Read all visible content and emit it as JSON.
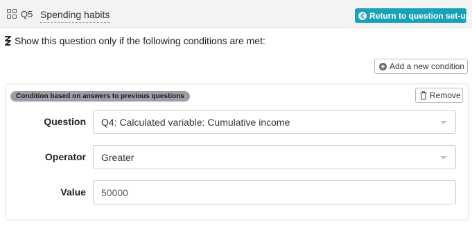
{
  "header": {
    "question_number": "Q5",
    "question_title": "Spending habits",
    "return_button_label": "Return to question set-up"
  },
  "conditions_intro": "Show this question only if the following conditions are met:",
  "add_condition_label": "Add a new condition",
  "condition": {
    "badge": "Condition based on answers to previous questions",
    "remove_label": "Remove",
    "question_label": "Question",
    "question_value": "Q4: Calculated variable: Cumulative income",
    "operator_label": "Operator",
    "operator_value": "Greater",
    "value_label": "Value",
    "value_value": "50000"
  },
  "colors": {
    "accent": "#17a2b8",
    "badge": "#9aa0a6"
  },
  "icons": {
    "question_type": "grid-icon",
    "return": "arrow-left-circle-icon",
    "conditions": "branch-icon",
    "add": "plus-circle-icon",
    "remove": "trash-icon",
    "dropdown": "caret-down-icon"
  }
}
